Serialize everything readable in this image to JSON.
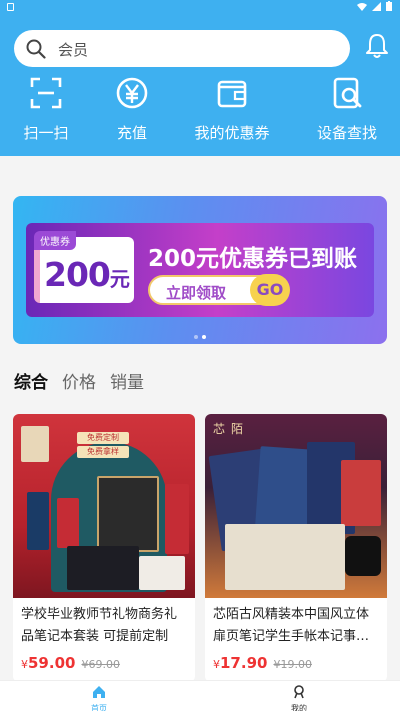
{
  "search": {
    "placeholder": "会员"
  },
  "quick_actions": [
    {
      "label": "扫一扫",
      "icon": "scan-icon"
    },
    {
      "label": "充值",
      "icon": "yen-circle-icon"
    },
    {
      "label": "我的优惠券",
      "icon": "wallet-icon"
    },
    {
      "label": "设备查找",
      "icon": "device-search-icon"
    }
  ],
  "banner": {
    "coupon_tag": "优惠券",
    "coupon_amount": "200",
    "coupon_unit": "元",
    "headline": "200元优惠券已到账",
    "claim_label": "立即领取",
    "go_label": "GO",
    "page_count": 2,
    "active_page": 2
  },
  "sort_tabs": [
    {
      "label": "综合",
      "active": true
    },
    {
      "label": "价格",
      "active": false
    },
    {
      "label": "销量",
      "active": false
    }
  ],
  "products": [
    {
      "title": "学校毕业教师节礼物商务礼品笔记本套装 可提前定制",
      "price_symbol": "¥",
      "price": "59.00",
      "original_price": "¥69.00",
      "image_text": [
        "免费定制",
        "免费拿样"
      ]
    },
    {
      "title": "芯陌古风精装本中国风立体扉页笔记学生手帐本记事…",
      "price_symbol": "¥",
      "price": "17.90",
      "original_price": "¥19.00",
      "image_text": [
        "芯",
        "陌"
      ]
    }
  ],
  "tabbar": [
    {
      "label": "首页",
      "icon": "home-icon",
      "active": true
    },
    {
      "label": "我的",
      "icon": "profile-icon",
      "active": false
    }
  ],
  "colors": {
    "primary": "#3eb0f0",
    "price": "#e33333"
  }
}
